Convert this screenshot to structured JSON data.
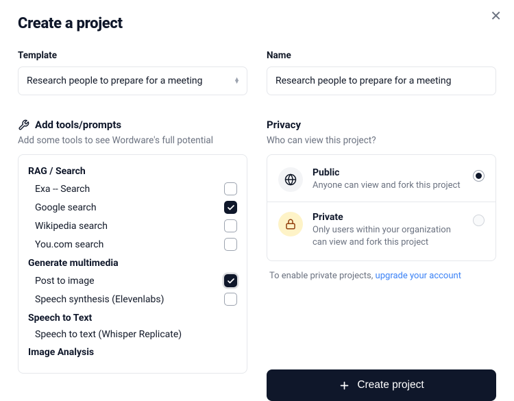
{
  "dialog": {
    "title": "Create a project"
  },
  "template": {
    "label": "Template",
    "value": "Research people to prepare for a meeting"
  },
  "name": {
    "label": "Name",
    "value": "Research people to prepare for a meeting"
  },
  "tools": {
    "heading": "Add tools/prompts",
    "helper": "Add some tools to see Wordware's full potential",
    "groups": [
      {
        "title": "RAG / Search",
        "items": [
          {
            "label": "Exa -- Search",
            "checked": false
          },
          {
            "label": "Google search",
            "checked": true
          },
          {
            "label": "Wikipedia search",
            "checked": false
          },
          {
            "label": "You.com search",
            "checked": false
          }
        ]
      },
      {
        "title": "Generate multimedia",
        "items": [
          {
            "label": "Post to image",
            "checked": true,
            "focused": true
          },
          {
            "label": "Speech synthesis (Elevenlabs)",
            "checked": false
          }
        ]
      },
      {
        "title": "Speech to Text",
        "items": [
          {
            "label": "Speech to text (Whisper Replicate)",
            "checked": false,
            "hideCheckbox": true
          }
        ]
      },
      {
        "title": "Image Analysis",
        "items": []
      }
    ]
  },
  "privacy": {
    "heading": "Privacy",
    "helper": "Who can view this project?",
    "options": [
      {
        "key": "public",
        "title": "Public",
        "desc": "Anyone can view and fork this project",
        "selected": true
      },
      {
        "key": "private",
        "title": "Private",
        "desc": "Only users within your organization can view and fork this project",
        "selected": false,
        "disabled": true
      }
    ],
    "upgrade_prefix": "To enable private projects, ",
    "upgrade_link": "upgrade your account"
  },
  "actions": {
    "create": "Create project"
  }
}
